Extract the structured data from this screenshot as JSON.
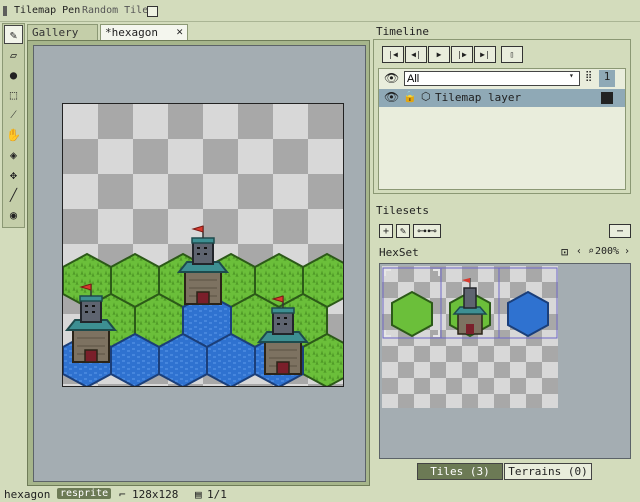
{
  "context_bar": {
    "tool_name": "Tilemap Pen",
    "option_label": "Random Tile",
    "option_checked": false
  },
  "tools": [
    {
      "icon": "pencil-icon",
      "glyph": "✎",
      "selected": true
    },
    {
      "icon": "eraser-icon",
      "glyph": "▱"
    },
    {
      "icon": "blur-icon",
      "glyph": "●"
    },
    {
      "icon": "rect-marquee-icon",
      "glyph": "⬚"
    },
    {
      "icon": "eyedropper-icon",
      "glyph": "⁄"
    },
    {
      "icon": "hand-icon",
      "glyph": "✋"
    },
    {
      "icon": "paint-bucket-icon",
      "glyph": "◈"
    },
    {
      "icon": "move-icon",
      "glyph": "✥"
    },
    {
      "icon": "line-icon",
      "glyph": "╱"
    },
    {
      "icon": "ink-drop-icon",
      "glyph": "◉"
    }
  ],
  "tabs": [
    {
      "label": "Gallery"
    },
    {
      "label": "*hexagon"
    }
  ],
  "timeline": {
    "title": "Timeline",
    "filter_value": "All",
    "frame_number": "1",
    "layer_name": "Tilemap layer"
  },
  "tilesets": {
    "title": "Tilesets",
    "tileset_name": "HexSet",
    "zoom": "200%",
    "tabs": [
      {
        "label": "Tiles (3)",
        "active": true
      },
      {
        "label": "Terrains (0)",
        "active": false
      }
    ]
  },
  "status": {
    "doc_name": "hexagon",
    "badge": "resprite",
    "size": "128x128",
    "frames": "1/1"
  },
  "colors": {
    "accent": "#8fa9b6",
    "grass": "#6bbf3a",
    "water": "#2f72d0",
    "tower_roof": "#3d8f92",
    "flag": "#d83a2f"
  }
}
